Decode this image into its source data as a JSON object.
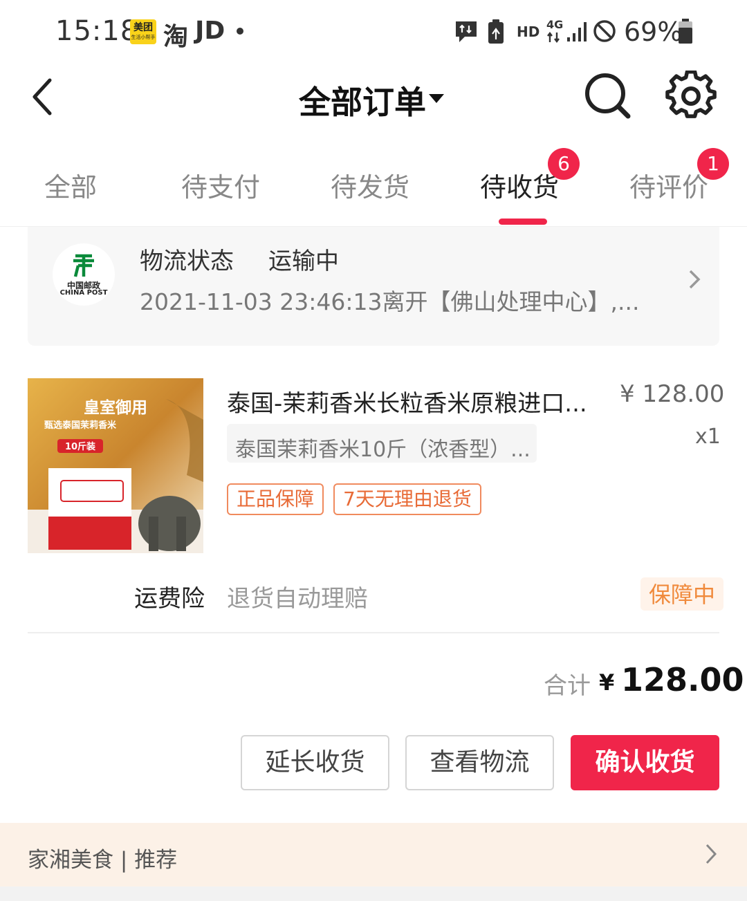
{
  "status_bar": {
    "time": "15:18",
    "meituan_label": "美团",
    "meituan_sub": "生活小帮手",
    "taobao_label": "淘",
    "jd_label": "JD",
    "hd_label": "HD",
    "network_label": "4G",
    "battery_text": "69%",
    "icons": [
      "notification-icon",
      "battery-saver-icon",
      "signal-icon",
      "do-not-disturb-icon",
      "battery-icon"
    ]
  },
  "header": {
    "title": "全部订单",
    "back_icon": "back-arrow-icon",
    "search_icon": "search-icon",
    "settings_icon": "gear-icon"
  },
  "tabs": [
    {
      "label": "全部",
      "active": false
    },
    {
      "label": "待支付",
      "active": false
    },
    {
      "label": "待发货",
      "active": false
    },
    {
      "label": "待收货",
      "active": true,
      "badge": "6"
    },
    {
      "label": "待评价",
      "active": false,
      "badge": "1"
    }
  ],
  "logistics": {
    "carrier_cn": "中国邮政",
    "carrier_en": "CHINA POST",
    "label": "物流状态",
    "status": "运输中",
    "detail": "2021-11-03 23:46:13离开【佛山处理中心】,..."
  },
  "product": {
    "title": "泰国-茉莉香米长粒香米原粮进口...",
    "price": "¥ 128.00",
    "quantity": "x1",
    "sku": "泰国茉莉香米10斤（浓香型）...",
    "tags": [
      "正品保障",
      "7天无理由退货"
    ],
    "image_text": {
      "headline": "皇室御用",
      "subline": "甄选泰国茉莉香米",
      "pack": "10斤装"
    }
  },
  "insurance": {
    "label": "运费险",
    "desc": "退货自动理赔",
    "status": "保障中"
  },
  "total": {
    "label": "合计",
    "currency": "¥",
    "amount": "128.00"
  },
  "actions": {
    "extend": "延长收货",
    "logistics": "查看物流",
    "confirm": "确认收货"
  },
  "recommend": {
    "text": "家湘美食 | 推荐"
  },
  "colors": {
    "accent": "#f0254a",
    "tag_orange": "#e86b37",
    "recommend_bg": "#fcf1e7"
  }
}
